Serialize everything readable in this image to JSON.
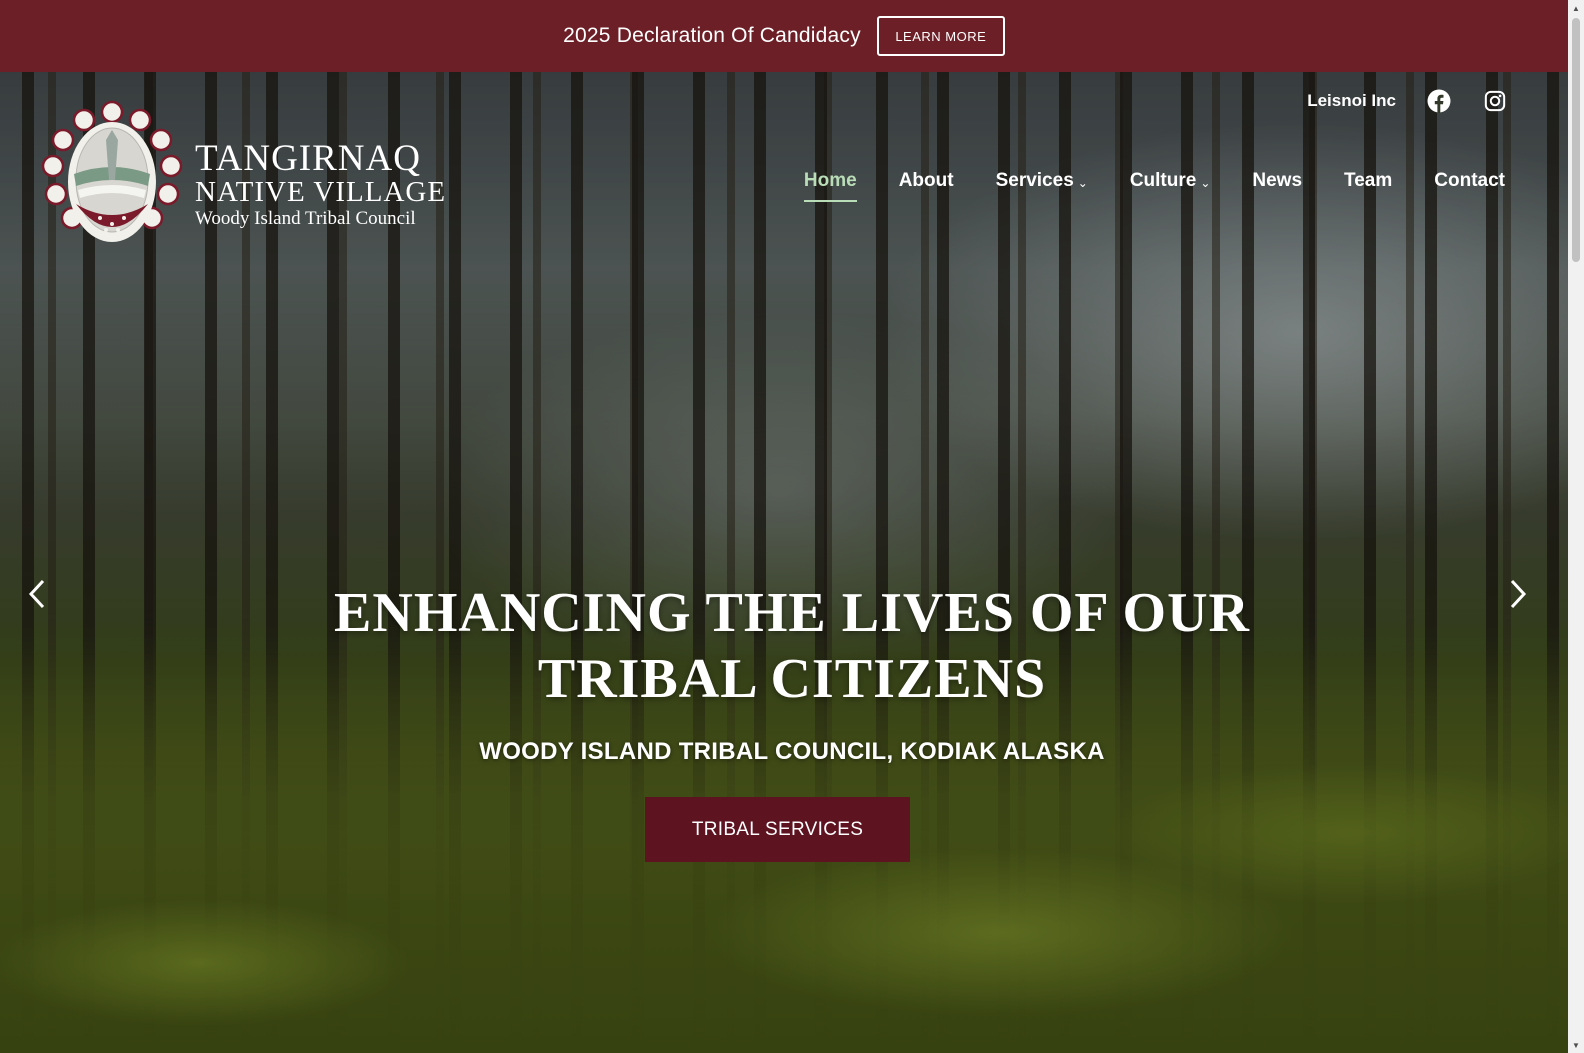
{
  "announcement": {
    "text": "2025 Declaration Of Candidacy",
    "button_label": "LEARN MORE",
    "background": "#6d1f27"
  },
  "logo": {
    "line1": "TANGIRNAQ",
    "line2": "NATIVE VILLAGE",
    "line3": "Woody Island Tribal Council"
  },
  "top_links": {
    "leisnoi": "Leisnoi Inc",
    "facebook_icon": "facebook-icon",
    "instagram_icon": "instagram-icon"
  },
  "nav": {
    "home": "Home",
    "about": "About",
    "services": "Services",
    "culture": "Culture",
    "news": "News",
    "team": "Team",
    "contact": "Contact",
    "active_color": "#b9ddb7"
  },
  "hero": {
    "title_line1": "ENHANCING THE LIVES OF OUR",
    "title_line2": "TRIBAL CITIZENS",
    "subtitle": "WOODY ISLAND TRIBAL COUNCIL, KODIAK ALASKA",
    "cta_label": "TRIBAL SERVICES",
    "cta_color": "#5d1320"
  }
}
